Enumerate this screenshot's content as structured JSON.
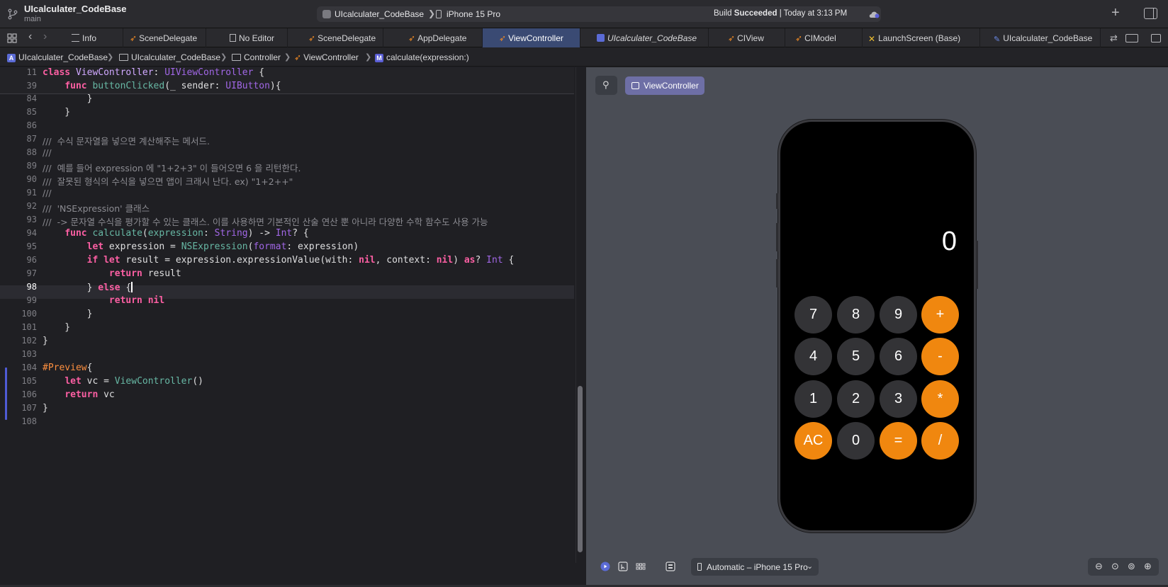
{
  "titlebar": {
    "project": "UIcalculater_CodeBase",
    "branch": "main",
    "scheme": "UIcalculater_CodeBase",
    "device": "iPhone 15 Pro",
    "status_prefix": "Build ",
    "status_bold": "Succeeded",
    "status_suffix": " | Today at 3:13 PM"
  },
  "tabs": [
    {
      "label": "Info",
      "icon": "list-icon"
    },
    {
      "label": "SceneDelegate",
      "icon": "swift-icon"
    },
    {
      "label": "No Editor",
      "icon": "doc-icon"
    },
    {
      "label": "SceneDelegate",
      "icon": "swift-icon"
    },
    {
      "label": "AppDelegate",
      "icon": "swift-icon"
    },
    {
      "label": "ViewController",
      "icon": "swift-icon",
      "active": true
    },
    {
      "label": "UIcalculater_CodeBase",
      "icon": "app-icon",
      "italic": true
    },
    {
      "label": "CIView",
      "icon": "swift-icon"
    },
    {
      "label": "CIModel",
      "icon": "swift-icon"
    },
    {
      "label": "LaunchScreen (Base)",
      "icon": "storyboard-icon"
    },
    {
      "label": "UIcalculater_CodeBase",
      "icon": "project-icon"
    }
  ],
  "breadcrumb": [
    "UIcalculater_CodeBase",
    "UIcalculater_CodeBase",
    "Controller",
    "ViewController",
    "calculate(expression:)"
  ],
  "editor": {
    "line_numbers": [
      "11",
      "39",
      "84",
      "85",
      "86",
      "87",
      "88",
      "89",
      "90",
      "91",
      "92",
      "93",
      "94",
      "95",
      "96",
      "97",
      "98",
      "99",
      "100",
      "101",
      "102",
      "103",
      "104",
      "105",
      "106",
      "107",
      "108"
    ],
    "comments": {
      "c87": "///  수식 문자열을 넣으면 계산해주는 메서드.",
      "c88": "///",
      "c89": "///  예를 들어 expression 에 \"1+2+3\" 이 들어오면 6 을 리턴한다.",
      "c90": "///  잘못된 형식의 수식을 넣으면 앱이 크래시 난다. ex) \"1+2++\"",
      "c91": "///",
      "c92": "///  'NSExpression' 클래스",
      "c93": "///  -> 문자열 수식을 평가할 수 있는 클래스. 이를 사용하면 기본적인 산술 연산 뿐 아니라 다양한 수학 함수도 사용 가능"
    }
  },
  "preview": {
    "chip_label": "ViewController",
    "display": "0",
    "keys": [
      [
        "7",
        "8",
        "9",
        "+"
      ],
      [
        "4",
        "5",
        "6",
        "-"
      ],
      [
        "1",
        "2",
        "3",
        "*"
      ],
      [
        "AC",
        "0",
        "=",
        "/"
      ]
    ],
    "device_selector": "Automatic – iPhone 15 Pro"
  },
  "colors": {
    "operator_key": "#f0870f",
    "number_key": "#333336",
    "active_tab": "#3a4a73",
    "keyword": "#fc5fa3"
  }
}
